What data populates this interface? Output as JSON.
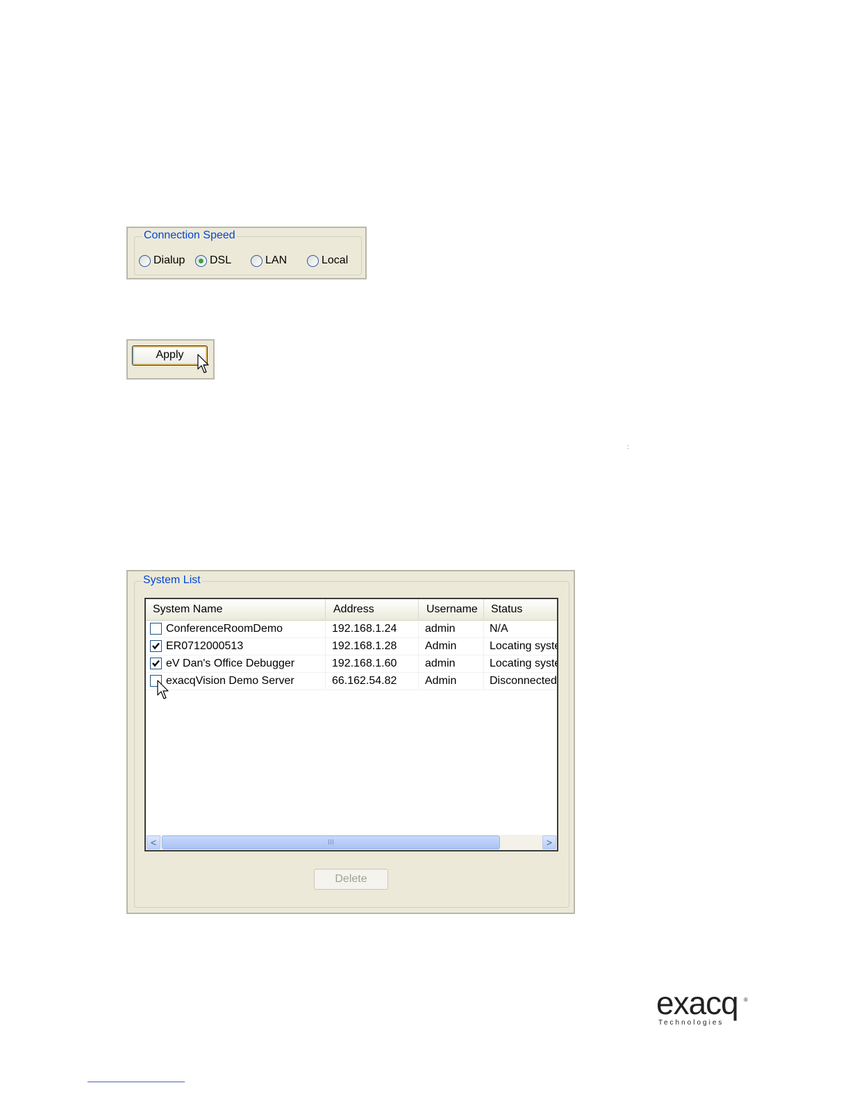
{
  "connection_speed": {
    "legend": "Connection Speed",
    "options": [
      "Dialup",
      "DSL",
      "LAN",
      "Local"
    ],
    "selected": "DSL"
  },
  "apply": {
    "label": "Apply"
  },
  "page_mark": ":",
  "system_list": {
    "legend": "System List",
    "columns": [
      "System Name",
      "Address",
      "Username",
      "Status"
    ],
    "rows": [
      {
        "checked": false,
        "name": "ConferenceRoomDemo",
        "address": "192.168.1.24",
        "username": "admin",
        "status": "N/A"
      },
      {
        "checked": true,
        "name": "ER0712000513",
        "address": "192.168.1.28",
        "username": "Admin",
        "status": "Locating syste"
      },
      {
        "checked": true,
        "name": "eV Dan's Office Debugger",
        "address": "192.168.1.60",
        "username": "admin",
        "status": "Locating syste"
      },
      {
        "checked": false,
        "name": "exacqVision Demo Server",
        "address": "66.162.54.82",
        "username": "Admin",
        "status": "Disconnected"
      }
    ],
    "scroll_left": "<",
    "scroll_right": ">",
    "scroll_grip": "III",
    "delete_label": "Delete"
  },
  "logo": {
    "word": "exacq",
    "sub": "Technologies",
    "reg": "®"
  },
  "icons": {
    "cursor": "cursor-arrow-icon",
    "checkmark": "checkmark-icon"
  }
}
